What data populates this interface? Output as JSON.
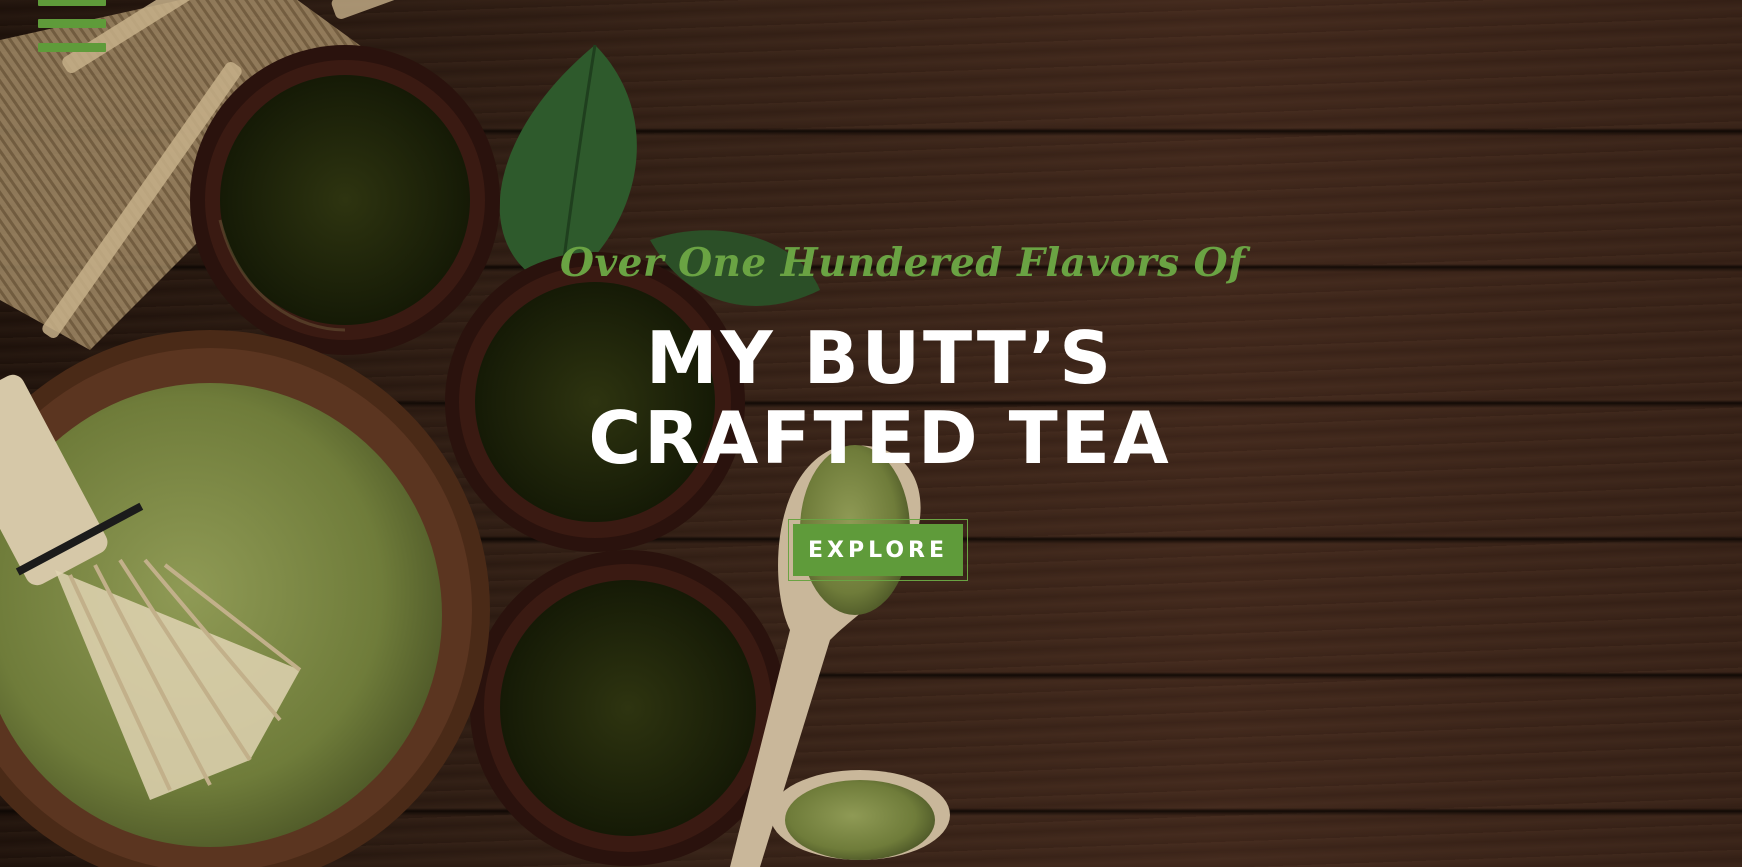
{
  "nav": {
    "menu_icon": "hamburger-menu-icon",
    "menu_color": "#5f9b3a"
  },
  "hero": {
    "tagline": "Over One Hundered Flavors Of",
    "title_line1": "MY BUTT’S",
    "title_line2": "CRAFTED TEA",
    "explore_label": "EXPLORE",
    "accent_color": "#6aa343",
    "background_image": "wooden-table-with-matcha-tea-cups"
  }
}
